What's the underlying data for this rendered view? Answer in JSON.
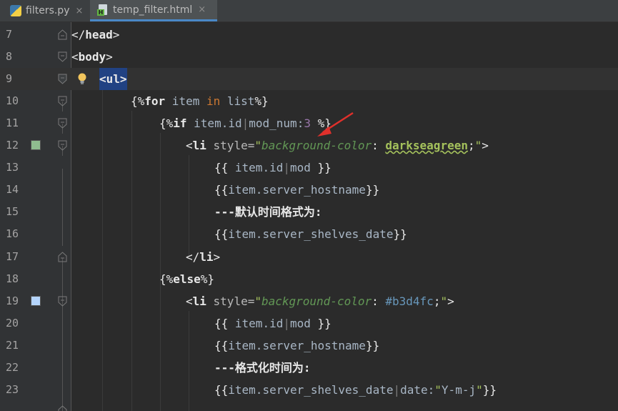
{
  "tabs": [
    {
      "label": "filters.py",
      "icon": "python-file-icon",
      "active": false
    },
    {
      "label": "temp_filter.html",
      "icon": "html-file-icon",
      "active": true
    }
  ],
  "tab_close_glyph": "×",
  "current_line": 9,
  "colors": {
    "swatch_12": "#8fbc8f",
    "swatch_19": "#b3d4fc",
    "arrow": "#e0302b"
  },
  "lines": [
    {
      "n": "7",
      "segs": [
        "</",
        "head",
        ">"
      ]
    },
    {
      "n": "8",
      "segs": [
        "<",
        "body",
        ">"
      ]
    },
    {
      "n": "9",
      "segs": [
        "<ul>"
      ]
    },
    {
      "n": "10",
      "segs": [
        "{%",
        "for",
        " item ",
        "in",
        " list",
        "%}"
      ]
    },
    {
      "n": "11",
      "segs": [
        "{%",
        "if",
        " item",
        ".",
        "id",
        "|",
        "mod_num",
        ":",
        "3",
        " %}"
      ]
    },
    {
      "n": "12",
      "segs": [
        "<",
        "li",
        " style=",
        "\"",
        "background-color",
        ": ",
        "darkseagreen",
        ";",
        "\"",
        ">"
      ]
    },
    {
      "n": "13",
      "segs": [
        "{{ ",
        "item",
        ".",
        "id",
        "|",
        "mod",
        " }}"
      ]
    },
    {
      "n": "14",
      "segs": [
        "{{",
        "item",
        ".",
        "server_hostname",
        "}}"
      ]
    },
    {
      "n": "15",
      "segs": [
        "---默认时间格式为:"
      ]
    },
    {
      "n": "16",
      "segs": [
        "{{",
        "item",
        ".",
        "server_shelves_date",
        "}}"
      ]
    },
    {
      "n": "17",
      "segs": [
        "</",
        "li",
        ">"
      ]
    },
    {
      "n": "18",
      "segs": [
        "{%",
        "else",
        "%}"
      ]
    },
    {
      "n": "19",
      "segs": [
        "<",
        "li",
        " style=",
        "\"",
        "background-color",
        ": ",
        "#b3d4fc",
        ";",
        "\"",
        ">"
      ]
    },
    {
      "n": "20",
      "segs": [
        "{{ ",
        "item",
        ".",
        "id",
        "|",
        "mod",
        " }}"
      ]
    },
    {
      "n": "21",
      "segs": [
        "{{",
        "item",
        ".",
        "server_hostname",
        "}}"
      ]
    },
    {
      "n": "22",
      "segs": [
        "---格式化时间为:"
      ]
    },
    {
      "n": "23",
      "segs": [
        "{{",
        "item",
        ".",
        "server_shelves_date",
        "|",
        "date",
        ":",
        "\"",
        "Y-m-j",
        "\"",
        "}}"
      ]
    }
  ]
}
